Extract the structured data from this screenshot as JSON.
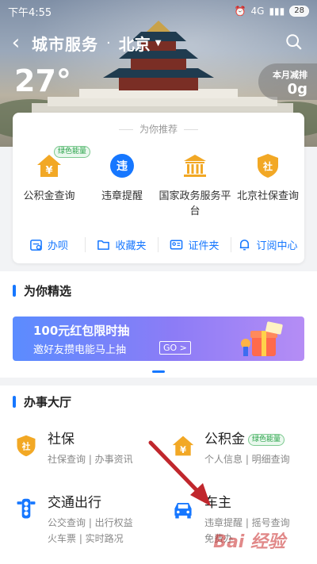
{
  "status": {
    "time": "下午4:55",
    "network": "4G",
    "battery": "28"
  },
  "nav": {
    "title": "城市服务",
    "separator": "·",
    "city": "北京",
    "caret": "▼"
  },
  "weather": {
    "temperature": "27°"
  },
  "emission": {
    "label": "本月减排",
    "value": "0g"
  },
  "recommend": {
    "title": "为你推荐",
    "items": [
      {
        "label": "公积金查询",
        "badge": "绿色能量",
        "icon": "yuan-house-icon"
      },
      {
        "label": "违章提醒",
        "icon": "violation-icon"
      },
      {
        "label": "国家政务服务平台",
        "icon": "government-building-icon"
      },
      {
        "label": "北京社保查询",
        "icon": "social-security-icon"
      }
    ],
    "tools": [
      {
        "label": "办呗",
        "icon": "calendar-icon"
      },
      {
        "label": "收藏夹",
        "icon": "folder-icon"
      },
      {
        "label": "证件夹",
        "icon": "id-card-icon"
      },
      {
        "label": "订阅中心",
        "icon": "bell-icon"
      }
    ]
  },
  "picks": {
    "title": "为你精选",
    "banner": {
      "title": "100元红包限时抽",
      "subtitle": "邀好友攒电能马上抽",
      "go": "GO >"
    }
  },
  "hall": {
    "title": "办事大厅",
    "services": [
      {
        "title": "社保",
        "sub": "社保查询 | 办事资讯",
        "icon": "social-security-icon"
      },
      {
        "title": "公积金",
        "badge": "绿色能量",
        "sub": "个人信息 | 明细查询",
        "icon": "yuan-house-icon"
      },
      {
        "title": "交通出行",
        "sub": "公交查询 | 出行权益",
        "sub2": "火车票 | 实时路况",
        "icon": "traffic-light-icon"
      },
      {
        "title": "车主",
        "sub": "违章提醒 | 摇号查询",
        "sub2": "免费办",
        "icon": "car-icon"
      }
    ]
  },
  "colors": {
    "accent": "#1677ff",
    "orange": "#f2a825",
    "green_badge": "#2aa34a",
    "arrow": "#c0272d"
  }
}
